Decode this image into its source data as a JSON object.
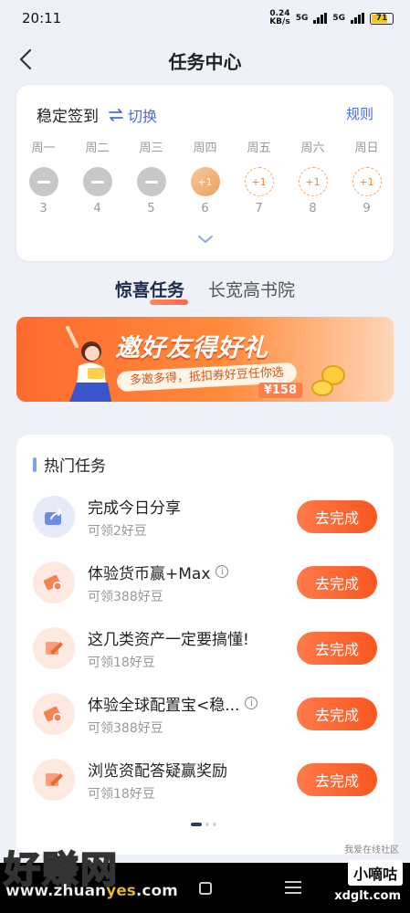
{
  "status_bar": {
    "time": "20:11",
    "net_speed_value": "0.24",
    "net_speed_unit": "KB/s",
    "sim1": "5G",
    "sim2": "5G",
    "battery": "71"
  },
  "header": {
    "title": "任务中心"
  },
  "signin": {
    "title": "稳定签到",
    "switch_label": "切换",
    "rules_label": "规则",
    "days": [
      {
        "weekday": "周一",
        "date": "3",
        "state": "done",
        "reward": ""
      },
      {
        "weekday": "周二",
        "date": "4",
        "state": "done",
        "reward": ""
      },
      {
        "weekday": "周三",
        "date": "5",
        "state": "done",
        "reward": ""
      },
      {
        "weekday": "周四",
        "date": "6",
        "state": "today",
        "reward": "+1"
      },
      {
        "weekday": "周五",
        "date": "7",
        "state": "future",
        "reward": "+1"
      },
      {
        "weekday": "周六",
        "date": "8",
        "state": "future",
        "reward": "+1"
      },
      {
        "weekday": "周日",
        "date": "9",
        "state": "future",
        "reward": "+1"
      }
    ]
  },
  "tabs": [
    {
      "label": "惊喜任务",
      "active": true
    },
    {
      "label": "长宽高书院",
      "active": false
    }
  ],
  "banner": {
    "title": "邀好友得好礼",
    "subtitle": "多邀多得，抵扣券好豆任你选",
    "price": "¥158"
  },
  "hot_tasks": {
    "title": "热门任务",
    "button_label": "去完成",
    "items": [
      {
        "name": "完成今日分享",
        "reward": "可领2好豆",
        "icon": "share-icon",
        "has_info": false
      },
      {
        "name": "体验货币赢+Max",
        "reward": "可领388好豆",
        "icon": "ticket-icon",
        "has_info": true
      },
      {
        "name": "这几类资产一定要搞懂!",
        "reward": "可领18好豆",
        "icon": "pencil-icon",
        "has_info": false
      },
      {
        "name": "体验全球配置宝<稳...",
        "reward": "可领388好豆",
        "icon": "ticket-icon",
        "has_info": true
      },
      {
        "name": "浏览资配答疑赢奖励",
        "reward": "可领18好豆",
        "icon": "pencil-icon",
        "has_info": false
      }
    ],
    "page_dots": 3,
    "active_page": 0
  },
  "watermark": {
    "site_cn": "好赚网",
    "site_url_a": "www.zhuan",
    "site_url_b": "yes",
    "site_url_c": ".com",
    "community": "我爱在线社区",
    "badge": "小嘀咕",
    "domain": "xdglt.com"
  },
  "colors": {
    "accent_orange": "#f9561f",
    "accent_blue": "#4a6ad8"
  }
}
